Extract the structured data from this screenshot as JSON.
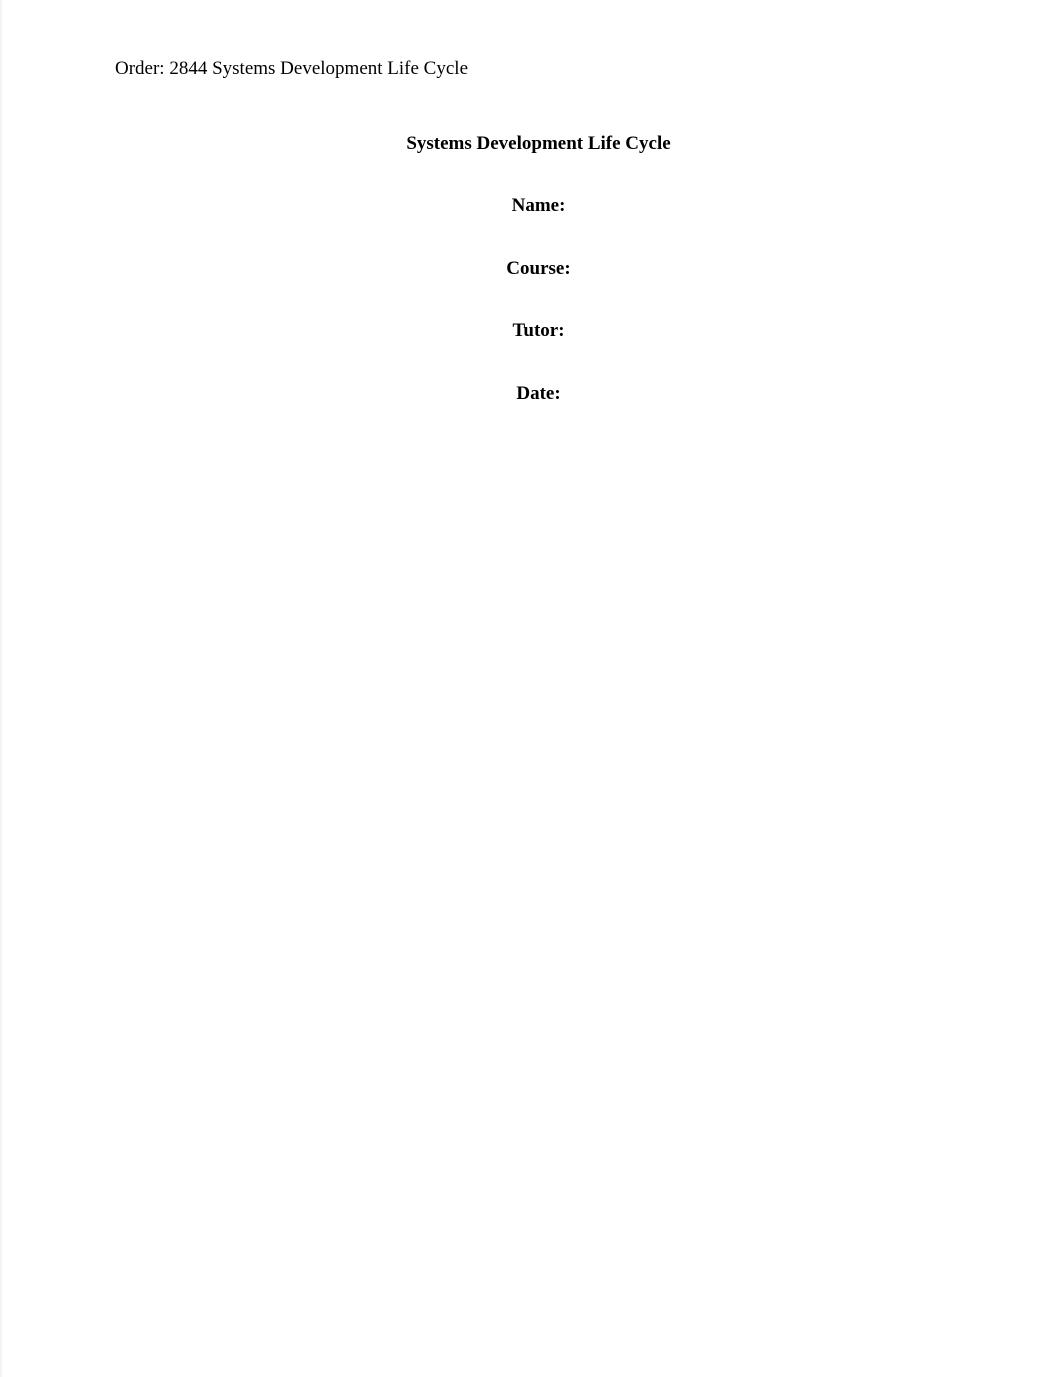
{
  "header": {
    "order_line": "Order: 2844 Systems Development Life Cycle"
  },
  "title": "Systems Development Life Cycle",
  "fields": {
    "name_label": "Name:",
    "course_label": "Course:",
    "tutor_label": "Tutor:",
    "date_label": "Date:"
  }
}
